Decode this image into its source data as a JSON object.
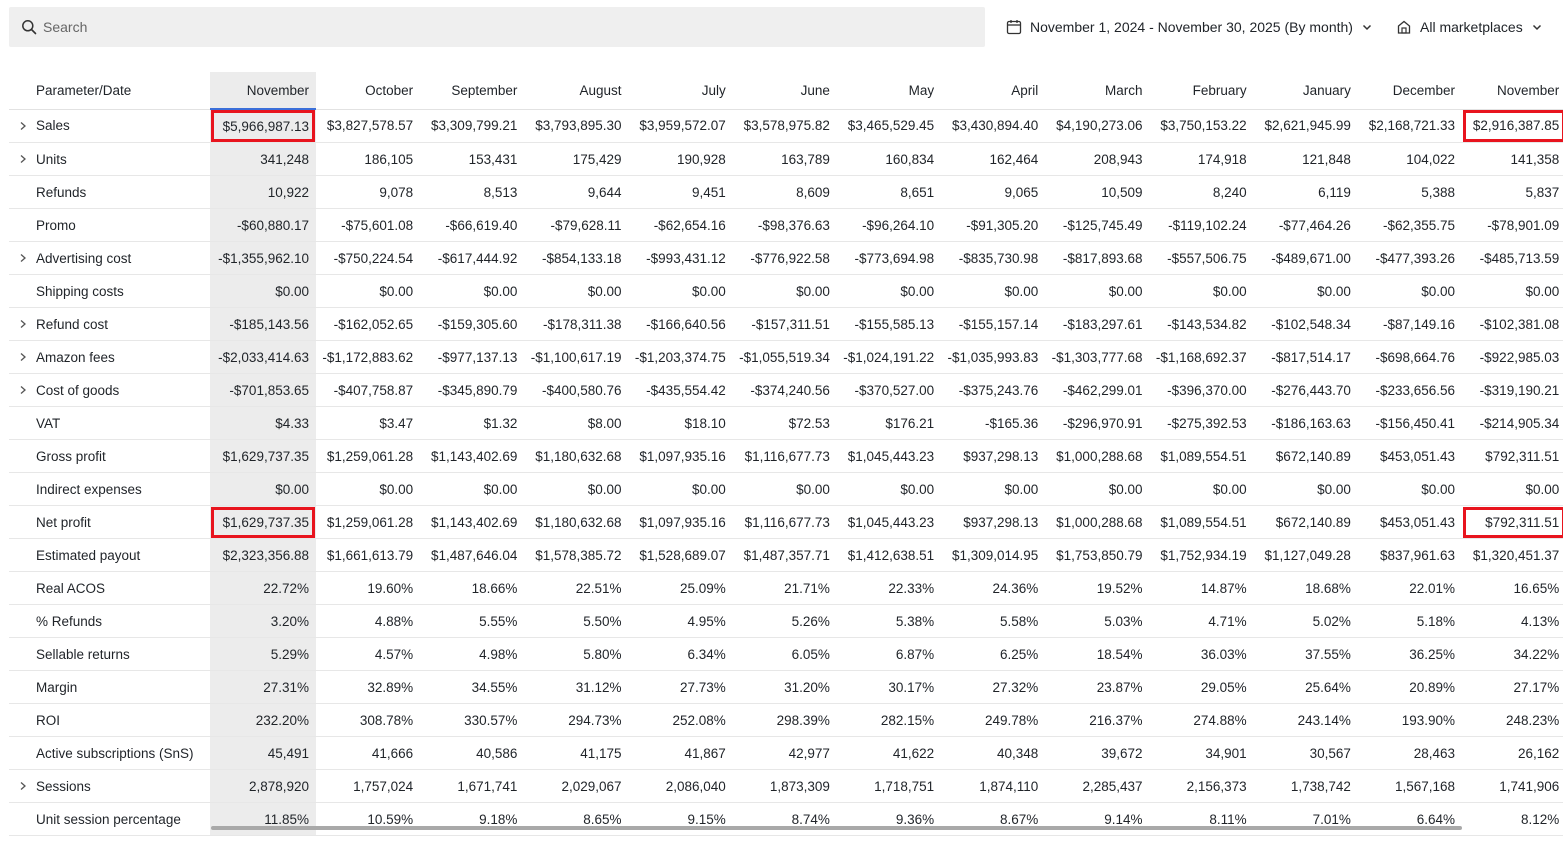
{
  "search": {
    "placeholder": "Search"
  },
  "filters": {
    "date_range": "November 1, 2024 - November 30, 2025 (By month)",
    "marketplace": "All marketplaces"
  },
  "icons": {
    "search": "search-icon",
    "calendar": "calendar-icon",
    "chevron": "chevron-down-icon",
    "marketplace": "store-icon",
    "expand": "chevron-right-icon"
  },
  "colors": {
    "highlight": "#e8141e",
    "selected_column": "#ececec",
    "selected_underline": "#3b6fd9"
  },
  "table": {
    "param_header": "Parameter/Date",
    "columns": [
      "November",
      "October",
      "September",
      "August",
      "July",
      "June",
      "May",
      "April",
      "March",
      "February",
      "January",
      "December",
      "November"
    ],
    "rows": [
      {
        "label": "Sales",
        "expandable": true,
        "highlight": [
          0,
          12
        ],
        "values": [
          "$5,966,987.13",
          "$3,827,578.57",
          "$3,309,799.21",
          "$3,793,895.30",
          "$3,959,572.07",
          "$3,578,975.82",
          "$3,465,529.45",
          "$3,430,894.40",
          "$4,190,273.06",
          "$3,750,153.22",
          "$2,621,945.99",
          "$2,168,721.33",
          "$2,916,387.85"
        ]
      },
      {
        "label": "Units",
        "expandable": true,
        "highlight": [],
        "values": [
          "341,248",
          "186,105",
          "153,431",
          "175,429",
          "190,928",
          "163,789",
          "160,834",
          "162,464",
          "208,943",
          "174,918",
          "121,848",
          "104,022",
          "141,358"
        ]
      },
      {
        "label": "Refunds",
        "expandable": false,
        "highlight": [],
        "values": [
          "10,922",
          "9,078",
          "8,513",
          "9,644",
          "9,451",
          "8,609",
          "8,651",
          "9,065",
          "10,509",
          "8,240",
          "6,119",
          "5,388",
          "5,837"
        ]
      },
      {
        "label": "Promo",
        "expandable": false,
        "highlight": [],
        "values": [
          "-$60,880.17",
          "-$75,601.08",
          "-$66,619.40",
          "-$79,628.11",
          "-$62,654.16",
          "-$98,376.63",
          "-$96,264.10",
          "-$91,305.20",
          "-$125,745.49",
          "-$119,102.24",
          "-$77,464.26",
          "-$62,355.75",
          "-$78,901.09"
        ]
      },
      {
        "label": "Advertising cost",
        "expandable": true,
        "highlight": [],
        "values": [
          "-$1,355,962.10",
          "-$750,224.54",
          "-$617,444.92",
          "-$854,133.18",
          "-$993,431.12",
          "-$776,922.58",
          "-$773,694.98",
          "-$835,730.98",
          "-$817,893.68",
          "-$557,506.75",
          "-$489,671.00",
          "-$477,393.26",
          "-$485,713.59"
        ]
      },
      {
        "label": "Shipping costs",
        "expandable": false,
        "highlight": [],
        "values": [
          "$0.00",
          "$0.00",
          "$0.00",
          "$0.00",
          "$0.00",
          "$0.00",
          "$0.00",
          "$0.00",
          "$0.00",
          "$0.00",
          "$0.00",
          "$0.00",
          "$0.00"
        ]
      },
      {
        "label": "Refund cost",
        "expandable": true,
        "highlight": [],
        "values": [
          "-$185,143.56",
          "-$162,052.65",
          "-$159,305.60",
          "-$178,311.38",
          "-$166,640.56",
          "-$157,311.51",
          "-$155,585.13",
          "-$155,157.14",
          "-$183,297.61",
          "-$143,534.82",
          "-$102,548.34",
          "-$87,149.16",
          "-$102,381.08"
        ]
      },
      {
        "label": "Amazon fees",
        "expandable": true,
        "highlight": [],
        "values": [
          "-$2,033,414.63",
          "-$1,172,883.62",
          "-$977,137.13",
          "-$1,100,617.19",
          "-$1,203,374.75",
          "-$1,055,519.34",
          "-$1,024,191.22",
          "-$1,035,993.83",
          "-$1,303,777.68",
          "-$1,168,692.37",
          "-$817,514.17",
          "-$698,664.76",
          "-$922,985.03"
        ]
      },
      {
        "label": "Cost of goods",
        "expandable": true,
        "highlight": [],
        "values": [
          "-$701,853.65",
          "-$407,758.87",
          "-$345,890.79",
          "-$400,580.76",
          "-$435,554.42",
          "-$374,240.56",
          "-$370,527.00",
          "-$375,243.76",
          "-$462,299.01",
          "-$396,370.00",
          "-$276,443.70",
          "-$233,656.56",
          "-$319,190.21"
        ]
      },
      {
        "label": "VAT",
        "expandable": false,
        "highlight": [],
        "values": [
          "$4.33",
          "$3.47",
          "$1.32",
          "$8.00",
          "$18.10",
          "$72.53",
          "$176.21",
          "-$165.36",
          "-$296,970.91",
          "-$275,392.53",
          "-$186,163.63",
          "-$156,450.41",
          "-$214,905.34"
        ]
      },
      {
        "label": "Gross profit",
        "expandable": false,
        "highlight": [],
        "values": [
          "$1,629,737.35",
          "$1,259,061.28",
          "$1,143,402.69",
          "$1,180,632.68",
          "$1,097,935.16",
          "$1,116,677.73",
          "$1,045,443.23",
          "$937,298.13",
          "$1,000,288.68",
          "$1,089,554.51",
          "$672,140.89",
          "$453,051.43",
          "$792,311.51"
        ]
      },
      {
        "label": "Indirect expenses",
        "expandable": false,
        "highlight": [],
        "values": [
          "$0.00",
          "$0.00",
          "$0.00",
          "$0.00",
          "$0.00",
          "$0.00",
          "$0.00",
          "$0.00",
          "$0.00",
          "$0.00",
          "$0.00",
          "$0.00",
          "$0.00"
        ]
      },
      {
        "label": "Net profit",
        "expandable": false,
        "highlight": [
          0,
          12
        ],
        "values": [
          "$1,629,737.35",
          "$1,259,061.28",
          "$1,143,402.69",
          "$1,180,632.68",
          "$1,097,935.16",
          "$1,116,677.73",
          "$1,045,443.23",
          "$937,298.13",
          "$1,000,288.68",
          "$1,089,554.51",
          "$672,140.89",
          "$453,051.43",
          "$792,311.51"
        ]
      },
      {
        "label": "Estimated payout",
        "expandable": false,
        "highlight": [],
        "values": [
          "$2,323,356.88",
          "$1,661,613.79",
          "$1,487,646.04",
          "$1,578,385.72",
          "$1,528,689.07",
          "$1,487,357.71",
          "$1,412,638.51",
          "$1,309,014.95",
          "$1,753,850.79",
          "$1,752,934.19",
          "$1,127,049.28",
          "$837,961.63",
          "$1,320,451.37"
        ]
      },
      {
        "label": "Real ACOS",
        "expandable": false,
        "highlight": [],
        "values": [
          "22.72%",
          "19.60%",
          "18.66%",
          "22.51%",
          "25.09%",
          "21.71%",
          "22.33%",
          "24.36%",
          "19.52%",
          "14.87%",
          "18.68%",
          "22.01%",
          "16.65%"
        ]
      },
      {
        "label": "% Refunds",
        "expandable": false,
        "highlight": [],
        "values": [
          "3.20%",
          "4.88%",
          "5.55%",
          "5.50%",
          "4.95%",
          "5.26%",
          "5.38%",
          "5.58%",
          "5.03%",
          "4.71%",
          "5.02%",
          "5.18%",
          "4.13%"
        ]
      },
      {
        "label": "Sellable returns",
        "expandable": false,
        "highlight": [],
        "values": [
          "5.29%",
          "4.57%",
          "4.98%",
          "5.80%",
          "6.34%",
          "6.05%",
          "6.87%",
          "6.25%",
          "18.54%",
          "36.03%",
          "37.55%",
          "36.25%",
          "34.22%"
        ]
      },
      {
        "label": "Margin",
        "expandable": false,
        "highlight": [],
        "values": [
          "27.31%",
          "32.89%",
          "34.55%",
          "31.12%",
          "27.73%",
          "31.20%",
          "30.17%",
          "27.32%",
          "23.87%",
          "29.05%",
          "25.64%",
          "20.89%",
          "27.17%"
        ]
      },
      {
        "label": "ROI",
        "expandable": false,
        "highlight": [],
        "values": [
          "232.20%",
          "308.78%",
          "330.57%",
          "294.73%",
          "252.08%",
          "298.39%",
          "282.15%",
          "249.78%",
          "216.37%",
          "274.88%",
          "243.14%",
          "193.90%",
          "248.23%"
        ]
      },
      {
        "label": "Active subscriptions (SnS)",
        "expandable": false,
        "highlight": [],
        "values": [
          "45,491",
          "41,666",
          "40,586",
          "41,175",
          "41,867",
          "42,977",
          "41,622",
          "40,348",
          "39,672",
          "34,901",
          "30,567",
          "28,463",
          "26,162"
        ]
      },
      {
        "label": "Sessions",
        "expandable": true,
        "highlight": [],
        "values": [
          "2,878,920",
          "1,757,024",
          "1,671,741",
          "2,029,067",
          "2,086,040",
          "1,873,309",
          "1,718,751",
          "1,874,110",
          "2,285,437",
          "2,156,373",
          "1,738,742",
          "1,567,168",
          "1,741,906"
        ]
      },
      {
        "label": "Unit session percentage",
        "expandable": false,
        "highlight": [],
        "values": [
          "11.85%",
          "10.59%",
          "9.18%",
          "8.65%",
          "9.15%",
          "8.74%",
          "9.36%",
          "8.67%",
          "9.14%",
          "8.11%",
          "7.01%",
          "6.64%",
          "8.12%"
        ]
      }
    ]
  }
}
